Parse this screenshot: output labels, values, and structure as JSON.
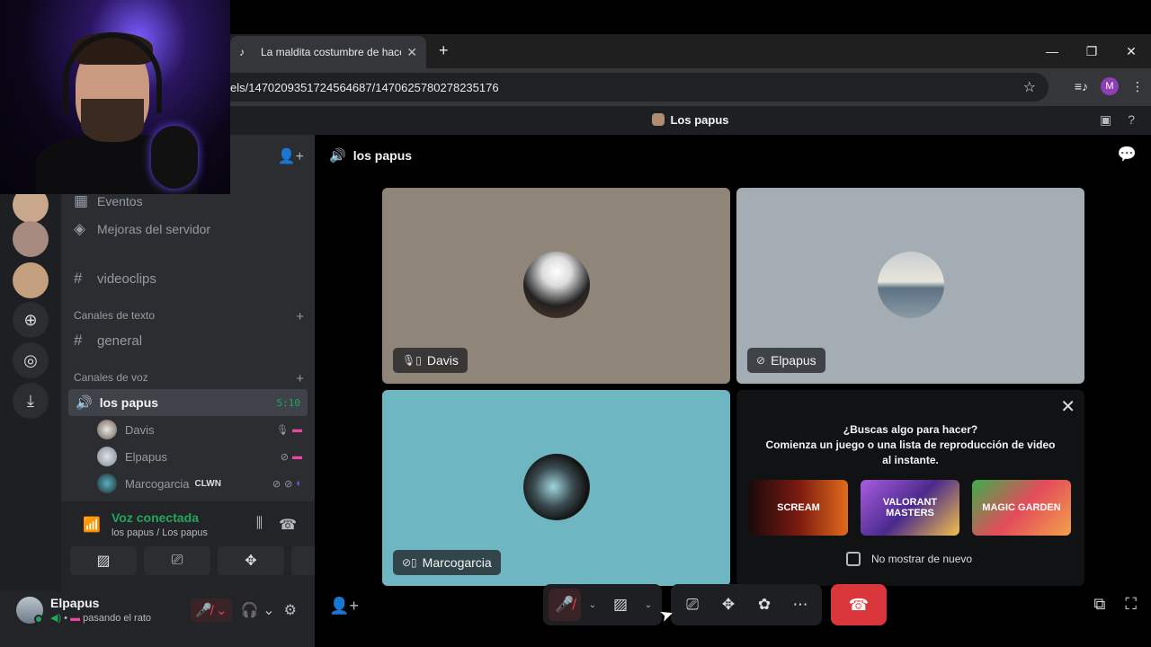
{
  "browser": {
    "tab_title": "La maldita costumbre de hacer",
    "url": "els/1470209351724564687/1470625780278235176",
    "profile_letter": "M"
  },
  "server": {
    "name": "Los papus"
  },
  "sidebar": {
    "items": {
      "eventos": "Eventos",
      "mejoras": "Mejoras del servidor",
      "videoclips": "videoclips",
      "cat_texto": "Canales de texto",
      "general": "general",
      "cat_voz": "Canales de voz",
      "voice_channel": "los papus",
      "voice_time": "5:10"
    },
    "members": [
      {
        "name": "Davis",
        "tag": ""
      },
      {
        "name": "Elpapus",
        "tag": ""
      },
      {
        "name": "Marcogarcia",
        "tag": "CLWN"
      }
    ]
  },
  "voice_panel": {
    "status": "Voz conectada",
    "subtitle": "los papus / Los papus"
  },
  "user": {
    "name": "Elpapus",
    "status": "pasando el rato"
  },
  "stage": {
    "channel": "los papus",
    "tiles": [
      {
        "name": "Davis",
        "color": "#8f8578"
      },
      {
        "name": "Elpapus",
        "color": "#a3adb3"
      },
      {
        "name": "Marcogarcia",
        "color": "#6fb6c3"
      }
    ],
    "promo": {
      "line1": "¿Buscas algo para hacer?",
      "line2": "Comienza un juego o una lista de reproducción de video",
      "line3": "al instante.",
      "games": [
        "SCREAM",
        "VALORANT MASTERS",
        "MAGIC GARDEN"
      ],
      "checkbox_label": "No mostrar de nuevo"
    }
  },
  "colors": {
    "green": "#23a55a",
    "red": "#da373c",
    "bg_sidebar": "#2b2d31"
  }
}
